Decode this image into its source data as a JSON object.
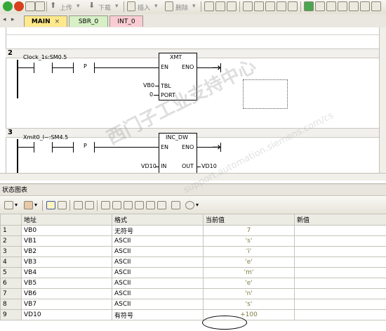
{
  "toolbar": {
    "upload_label": "上传",
    "download_label": "下载",
    "insert_label": "插入",
    "delete_label": "删除"
  },
  "tabs": [
    {
      "label": "MAIN",
      "color": "#ffe98a"
    },
    {
      "label": "SBR_0",
      "color": "#d7f0c6"
    },
    {
      "label": "INT_0",
      "color": "#f9ccd3"
    }
  ],
  "tab_close_glyph": "×",
  "ladder": {
    "networks": [
      {
        "number": "2",
        "contact_label": "Clock_1s:SM0.5",
        "p_label": "P",
        "box_title": "XMT",
        "en": "EN",
        "eno": "ENO",
        "inputs": [
          {
            "value": "VB0",
            "pin": "TBL"
          },
          {
            "value": "0",
            "pin": "PORT"
          }
        ]
      },
      {
        "number": "3",
        "contact_label": "Xmit0_I~:SM4.5",
        "p_label": "P",
        "box_title": "INC_DW",
        "en": "EN",
        "eno": "ENO",
        "in_value": "VD10",
        "in_pin": "IN",
        "out_pin": "OUT",
        "out_value": "VD10"
      }
    ]
  },
  "status_chart": {
    "title": "状态图表",
    "columns": [
      "",
      "地址",
      "格式",
      "当前值",
      "新值"
    ],
    "rows": [
      {
        "n": "1",
        "addr": "VB0",
        "fmt": "无符号",
        "cur": "7",
        "new": ""
      },
      {
        "n": "2",
        "addr": "VB1",
        "fmt": "ASCII",
        "cur": "'s'",
        "new": ""
      },
      {
        "n": "3",
        "addr": "VB2",
        "fmt": "ASCII",
        "cur": "'i'",
        "new": ""
      },
      {
        "n": "4",
        "addr": "VB3",
        "fmt": "ASCII",
        "cur": "'e'",
        "new": ""
      },
      {
        "n": "5",
        "addr": "VB4",
        "fmt": "ASCII",
        "cur": "'m'",
        "new": ""
      },
      {
        "n": "6",
        "addr": "VB5",
        "fmt": "ASCII",
        "cur": "'e'",
        "new": ""
      },
      {
        "n": "7",
        "addr": "VB6",
        "fmt": "ASCII",
        "cur": "'n'",
        "new": ""
      },
      {
        "n": "8",
        "addr": "VB7",
        "fmt": "ASCII",
        "cur": "'s'",
        "new": ""
      },
      {
        "n": "9",
        "addr": "VD10",
        "fmt": "有符号",
        "cur": "+100",
        "new": ""
      }
    ]
  },
  "watermark": "西门子工业支持中心",
  "watermark_url": "support.automation.siemens.com/cs"
}
